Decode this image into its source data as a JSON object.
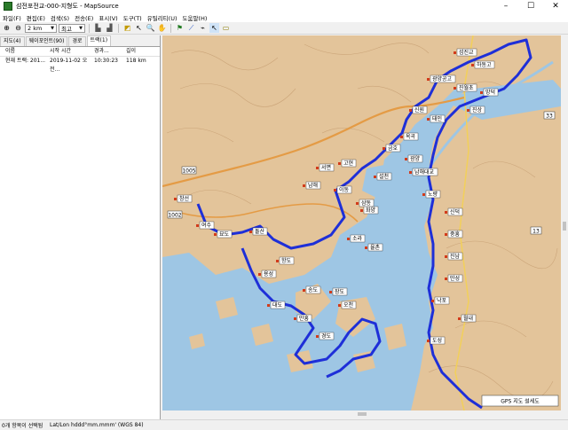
{
  "window": {
    "title": "섬전포전교-000-지형도 - MapSource"
  },
  "menu": [
    "파일(F)",
    "편집(E)",
    "검색(S)",
    "전송(E)",
    "표시(V)",
    "도구(T)",
    "유틸리티(U)",
    "도움말(H)"
  ],
  "toolbar": {
    "scale": "2 km",
    "detail": "최고"
  },
  "tabs": [
    "지도(4)",
    "웨이포인트(90)",
    "경로",
    "트랙(1)"
  ],
  "list": {
    "headers": [
      "이름",
      "시작 시간",
      "경과...",
      "길이"
    ],
    "rows": [
      [
        "현재 트랙: 201...",
        "2019-11-02 오전...",
        "10:30:23",
        "118 km"
      ]
    ]
  },
  "status": {
    "selection": "0개 항목이 선택됨",
    "coords": "Lat/Lon hddd°mm.mmm' (WGS 84)"
  },
  "map": {
    "road_labels": [
      "1005",
      "1002",
      "13",
      "33"
    ],
    "waypoints": [
      "섬진교",
      "하동고",
      "광양공고",
      "진월초",
      "망덕",
      "신원",
      "태인",
      "진상",
      "옥곡",
      "광양",
      "금호",
      "남해대교",
      "노량",
      "설천",
      "고현",
      "서면",
      "남해",
      "이동",
      "삼동",
      "창선",
      "여수",
      "묘도",
      "돌산",
      "화양",
      "소라",
      "율촌",
      "신덕",
      "중흥",
      "진남",
      "만성",
      "낙포",
      "월내",
      "도성",
      "항도",
      "용성",
      "대도",
      "송도",
      "장도",
      "오천",
      "만흥",
      "경도"
    ],
    "footer_label": "GPS 지도 설세도",
    "colors": {
      "land": "#e3c49a",
      "sea": "#9ec6e4",
      "route": "#1e2fd8",
      "road": "#e49b45"
    }
  }
}
